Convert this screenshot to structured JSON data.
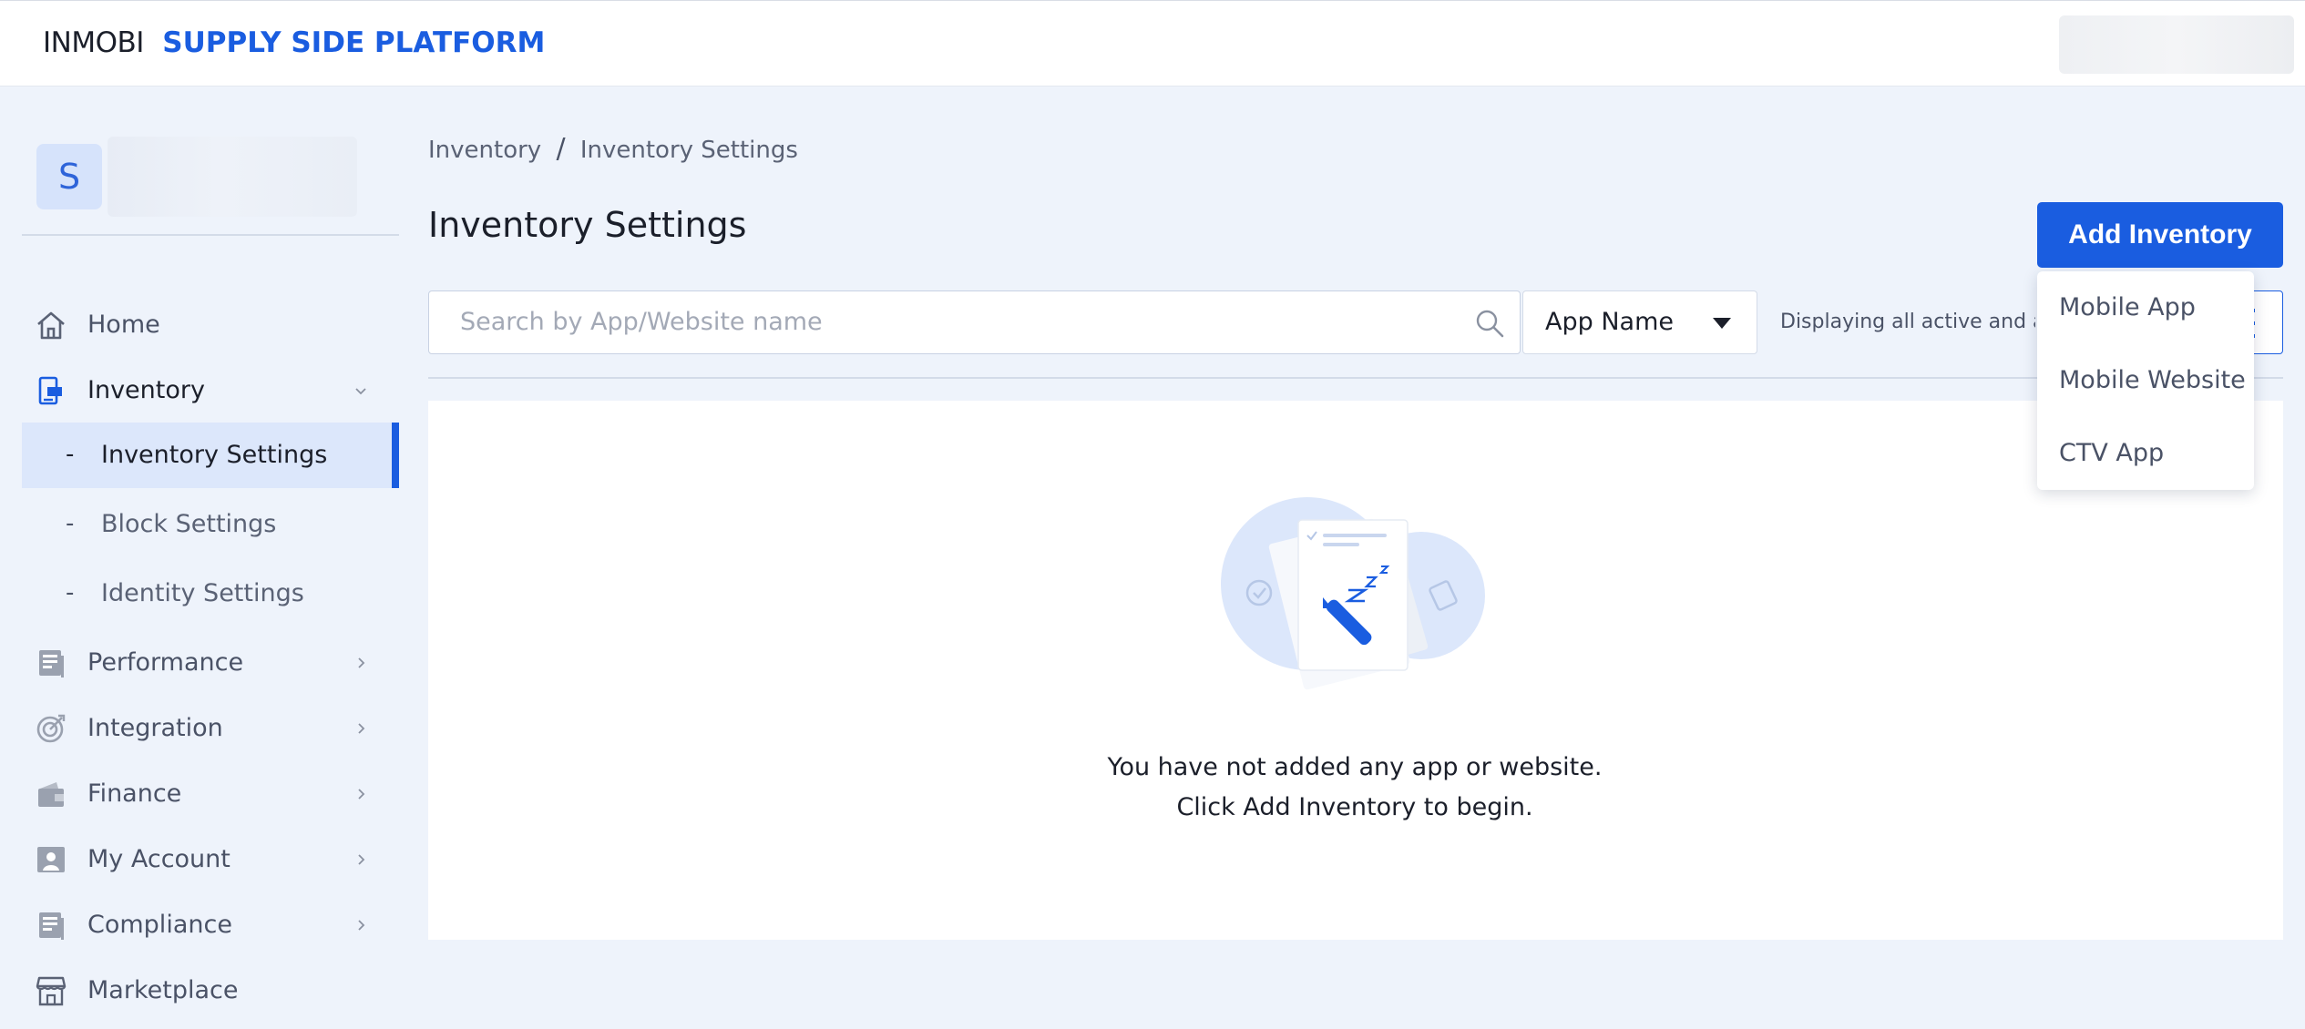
{
  "brand": {
    "name": "INMOBI",
    "product": "SUPPLY SIDE PLATFORM"
  },
  "account": {
    "avatar_letter": "S"
  },
  "sidebar": {
    "items": [
      {
        "label": "Home",
        "icon": "home-icon"
      },
      {
        "label": "Inventory",
        "icon": "inventory-icon",
        "expanded": true,
        "children": [
          {
            "label": "Inventory Settings",
            "active": true
          },
          {
            "label": "Block Settings"
          },
          {
            "label": "Identity Settings"
          }
        ]
      },
      {
        "label": "Performance",
        "icon": "report-icon"
      },
      {
        "label": "Integration",
        "icon": "target-icon"
      },
      {
        "label": "Finance",
        "icon": "wallet-icon"
      },
      {
        "label": "My Account",
        "icon": "user-card-icon"
      },
      {
        "label": "Compliance",
        "icon": "document-icon"
      },
      {
        "label": "Marketplace",
        "icon": "store-icon"
      }
    ],
    "child_prefix": "-"
  },
  "breadcrumb": {
    "parent": "Inventory",
    "separator": "/",
    "current": "Inventory Settings"
  },
  "page": {
    "title": "Inventory Settings"
  },
  "toolbar": {
    "add_button": "Add Inventory",
    "search_placeholder": "Search by App/Website name",
    "filter_selected": "App Name",
    "display_text": "Displaying all active and a"
  },
  "add_menu": {
    "items": [
      "Mobile App",
      "Mobile Website",
      "CTV App"
    ]
  },
  "empty_state": {
    "line1": "You have not added any app or website.",
    "line2": "Click Add Inventory to begin."
  },
  "colors": {
    "accent": "#1a5de0",
    "background": "#eef3fb",
    "active_bg": "#dce7fb"
  }
}
